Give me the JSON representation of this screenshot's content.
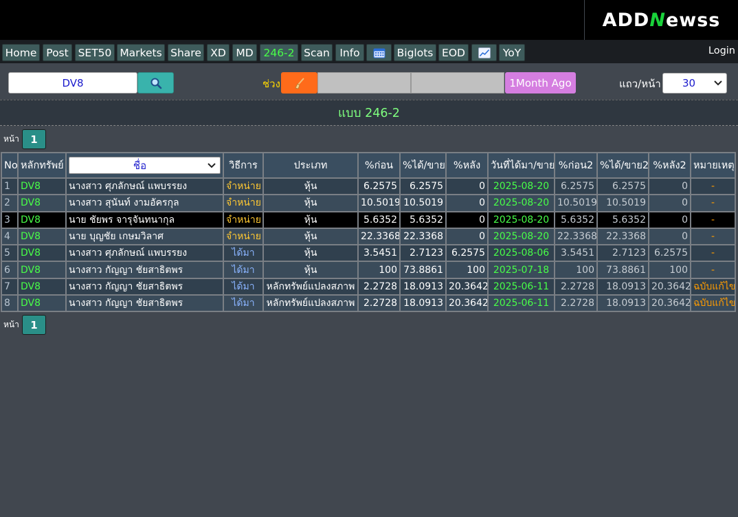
{
  "logo": {
    "text_pre": "ADD",
    "text_n": "N",
    "text_post": "ewss"
  },
  "nav": {
    "tabs": [
      "Home",
      "Post",
      "SET50",
      "Markets",
      "Share",
      "XD",
      "MD",
      "246-2",
      "Scan",
      "Info",
      "calendar-icon",
      "Biglots",
      "EOD",
      "chart-icon",
      "YoY"
    ],
    "active": "246-2",
    "login": "Login"
  },
  "search": {
    "value": "DV8"
  },
  "range": {
    "label": "ช่วง",
    "month_button": "1Month Ago"
  },
  "perpage": {
    "label": "แถว/หน้า",
    "value": "30"
  },
  "title": "แบบ 246-2",
  "pagination": {
    "label": "หน้า",
    "page": "1"
  },
  "table": {
    "headers": [
      "No",
      "หลักทรัพย์",
      "ชื่อ",
      "วิธีการ",
      "ประเภท",
      "%ก่อน",
      "%ได้/ขาย",
      "%หลัง",
      "วันที่ได้มา/ขาย",
      "%ก่อน2",
      "%ได้/ขาย2",
      "%หลัง2",
      "หมายเหตุ"
    ],
    "rows": [
      {
        "no": "1",
        "sym": "DV8",
        "name": "นางสาว ศุภลักษณ์ แพบรรยง",
        "method": "จำหน่าย",
        "type": "หุ้น",
        "before": "6.2575",
        "trade": "6.2575",
        "after": "0",
        "date": "2025-08-20",
        "before2": "6.2575",
        "trade2": "6.2575",
        "after2": "0",
        "note": "-"
      },
      {
        "no": "2",
        "sym": "DV8",
        "name": "นางสาว สุนันท์ งามอัครกุล",
        "method": "จำหน่าย",
        "type": "หุ้น",
        "before": "10.5019",
        "trade": "10.5019",
        "after": "0",
        "date": "2025-08-20",
        "before2": "10.5019",
        "trade2": "10.5019",
        "after2": "0",
        "note": "-"
      },
      {
        "no": "3",
        "sym": "DV8",
        "name": "นาย ชัยพร จารุจันทนากุล",
        "method": "จำหน่าย",
        "type": "หุ้น",
        "before": "5.6352",
        "trade": "5.6352",
        "after": "0",
        "date": "2025-08-20",
        "before2": "5.6352",
        "trade2": "5.6352",
        "after2": "0",
        "note": "-"
      },
      {
        "no": "4",
        "sym": "DV8",
        "name": "นาย บุญชัย เกษมวิลาศ",
        "method": "จำหน่าย",
        "type": "หุ้น",
        "before": "22.3368",
        "trade": "22.3368",
        "after": "0",
        "date": "2025-08-20",
        "before2": "22.3368",
        "trade2": "22.3368",
        "after2": "0",
        "note": "-"
      },
      {
        "no": "5",
        "sym": "DV8",
        "name": "นางสาว ศุภลักษณ์ แพบรรยง",
        "method": "ได้มา",
        "type": "หุ้น",
        "before": "3.5451",
        "trade": "2.7123",
        "after": "6.2575",
        "date": "2025-08-06",
        "before2": "3.5451",
        "trade2": "2.7123",
        "after2": "6.2575",
        "note": "-"
      },
      {
        "no": "6",
        "sym": "DV8",
        "name": "นางสาว กัญญา ชัยสาธิตพร",
        "method": "ได้มา",
        "type": "หุ้น",
        "before": "100",
        "trade": "73.8861",
        "after": "100",
        "date": "2025-07-18",
        "before2": "100",
        "trade2": "73.8861",
        "after2": "100",
        "note": "-"
      },
      {
        "no": "7",
        "sym": "DV8",
        "name": "นางสาว กัญญา ชัยสาธิตพร",
        "method": "ได้มา",
        "type": "หลักทรัพย์แปลงสภาพ",
        "before": "2.2728",
        "trade": "18.0913",
        "after": "20.3642",
        "date": "2025-06-11",
        "before2": "2.2728",
        "trade2": "18.0913",
        "after2": "20.3642",
        "note": "ฉบับแก้ไข"
      },
      {
        "no": "8",
        "sym": "DV8",
        "name": "นางสาว กัญญา ชัยสาธิตพร",
        "method": "ได้มา",
        "type": "หลักทรัพย์แปลงสภาพ",
        "before": "2.2728",
        "trade": "18.0913",
        "after": "20.3642",
        "date": "2025-06-11",
        "before2": "2.2728",
        "trade2": "18.0913",
        "after2": "20.3642",
        "note": "ฉบับแก้ไข"
      }
    ],
    "highlighted_row": "3"
  }
}
